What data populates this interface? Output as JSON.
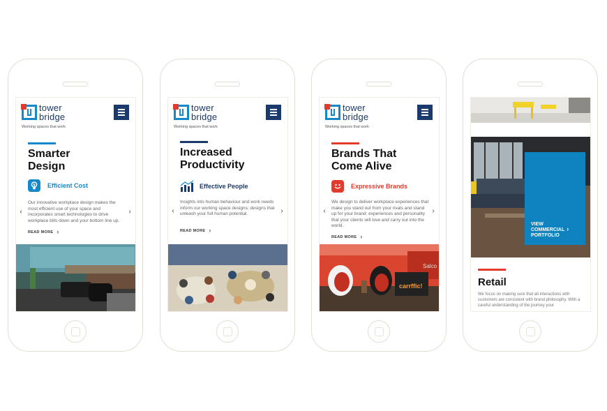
{
  "brand": {
    "name_line1": "tower",
    "name_line2": "bridge",
    "tagline": "Working spaces that work",
    "navy": "#1a3a6e",
    "blue": "#1488c8",
    "red": "#e23b2e"
  },
  "menu": {
    "icon": "hamburger-menu-icon"
  },
  "slides": [
    {
      "headline_line1": "Smarter",
      "headline_line2": "Design",
      "feature_label": "Efficient Cost",
      "feature_color": "#1488c8",
      "feature_icon": "lightbulb-icon",
      "accent_color": "#1488c8",
      "body": "Our innovative workplace design makes the most efficient use of your space and incorporates smart technologies to drive workplace bills down and your bottom line up.",
      "read_more": "READ MORE"
    },
    {
      "headline_line1": "Increased",
      "headline_line2": "Productivity",
      "feature_label": "Effective People",
      "feature_color": "#1a3a6e",
      "feature_icon": "growth-chart-icon",
      "accent_color": "#1a3a6e",
      "body": "Insights into human behaviour and work needs inform our working space designs; designs that unleash your full human potential.",
      "read_more": "READ MORE"
    },
    {
      "headline_line1": "Brands That",
      "headline_line2": "Come Alive",
      "feature_label": "Expressive Brands",
      "feature_color": "#e23b2e",
      "feature_icon": "speech-bubble-icon",
      "accent_color": "#e23b2e",
      "body": "We design to deliver workplace experiences that make you stand out from your rivals and stand up for your brand: experiences and personality that your clients will love and carry out into the world.",
      "read_more": "READ MORE"
    }
  ],
  "arrows": {
    "prev": "‹",
    "next": "›"
  },
  "portfolio": {
    "cta_line1": "VIEW",
    "cta_line2": "COMMERCIAL",
    "cta_line3": "PORTFOLIO",
    "section_title": "Retail",
    "section_text": "We focus on making sure that all interactions with customers are consistent with brand philosophy. With a careful understanding of the journey your"
  },
  "photo_brand_sign": "carrffic!",
  "photo_wall_text": "Salco"
}
